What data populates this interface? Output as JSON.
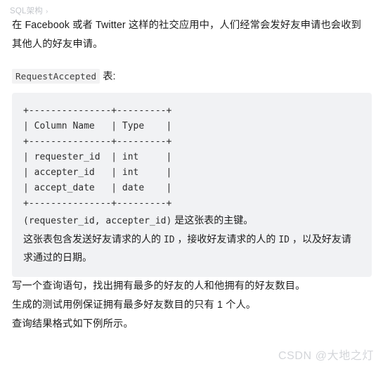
{
  "breadcrumb": {
    "label": "SQL架构",
    "separator": "›"
  },
  "article": {
    "intro": "在 Facebook 或者 Twitter 这样的社交应用中，人们经常会发好友申请也会收到其他人的好友申请。",
    "table_label_code": "RequestAccepted",
    "table_label_tail": "表:",
    "code_block": {
      "ascii_table": "+---------------+---------+\n| Column Name   | Type    |\n+---------------+---------+\n| requester_id  | int     |\n| accepter_id   | int     |\n| accept_date   | date    |\n+---------------+---------+",
      "note_1_code": "(requester_id, accepter_id)",
      "note_1_text": "是这张表的主键。",
      "note_2_a": "这张表包含发送好友请求的人的",
      "note_2_code_1": "ID",
      "note_2_b": "，接收好友请求的人的",
      "note_2_code_2": "ID",
      "note_2_c": "，以及好友请求通过的日期。"
    },
    "question_1": "写一个查询语句，找出拥有最多的好友的人和他拥有的好友数目。",
    "question_2": "生成的测试用例保证拥有最多好友数目的只有 1 个人。",
    "question_3": "查询结果格式如下例所示。"
  },
  "watermark": {
    "text": "CSDN @大地之灯"
  }
}
